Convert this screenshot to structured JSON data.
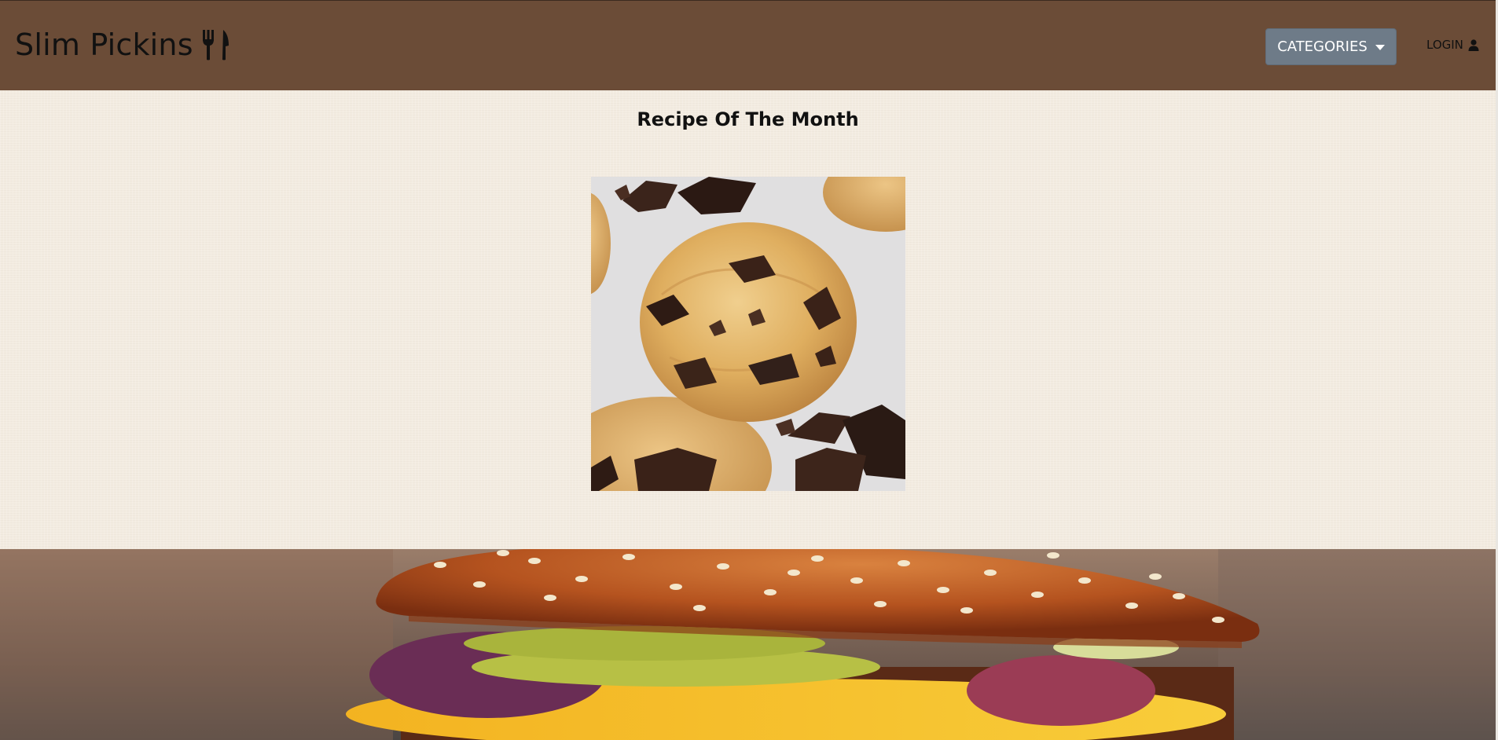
{
  "navbar": {
    "brand": "Slim Pickins",
    "brand_icon": "utensils-icon",
    "categories_label": "CATEGORIES",
    "login_label": "LOGIN",
    "login_icon": "user-icon",
    "background_color": "#6b4c37",
    "button_color": "#6e7b88"
  },
  "main": {
    "title": "Recipe Of The Month",
    "featured_image": "chocolate-chunk-cookie",
    "background_color": "#f3ece1"
  },
  "hero": {
    "image": "burger-hero"
  }
}
